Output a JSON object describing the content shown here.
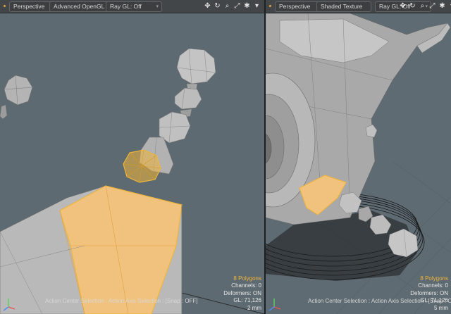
{
  "left": {
    "view_label": "Perspective",
    "shading_label": "Advanced OpenGL",
    "raygl_label": "Ray GL: Off",
    "hud": {
      "polygons": "8 Polygons",
      "channels": "Channels: 0",
      "deformers": "Deformers: ON",
      "gl": "GL: 71,126",
      "size": "2 mm"
    },
    "status": "Action Center Selection : Action Axis Selection : [Snap : OFF]"
  },
  "right": {
    "view_label": "Perspective",
    "shading_label": "Shaded Texture",
    "raygl_label": "Ray GL: Off",
    "hud": {
      "polygons": "8 Polygons",
      "channels": "Channels: 0",
      "deformers": "Deformers: ON",
      "gl": "GL: 71,126",
      "size": "5 mm"
    },
    "status": "Action Center Selection : Action Axis Selection : [Snap : OFF]"
  },
  "toolbar_icons": [
    "move-view-icon",
    "rotate-view-icon",
    "zoom-view-icon",
    "maximize-view-icon",
    "settings-gear-icon"
  ],
  "colors": {
    "selection": "#f0b53a",
    "viewport_bg": "#5e6a71",
    "mesh_grey": "#aeaeae"
  }
}
